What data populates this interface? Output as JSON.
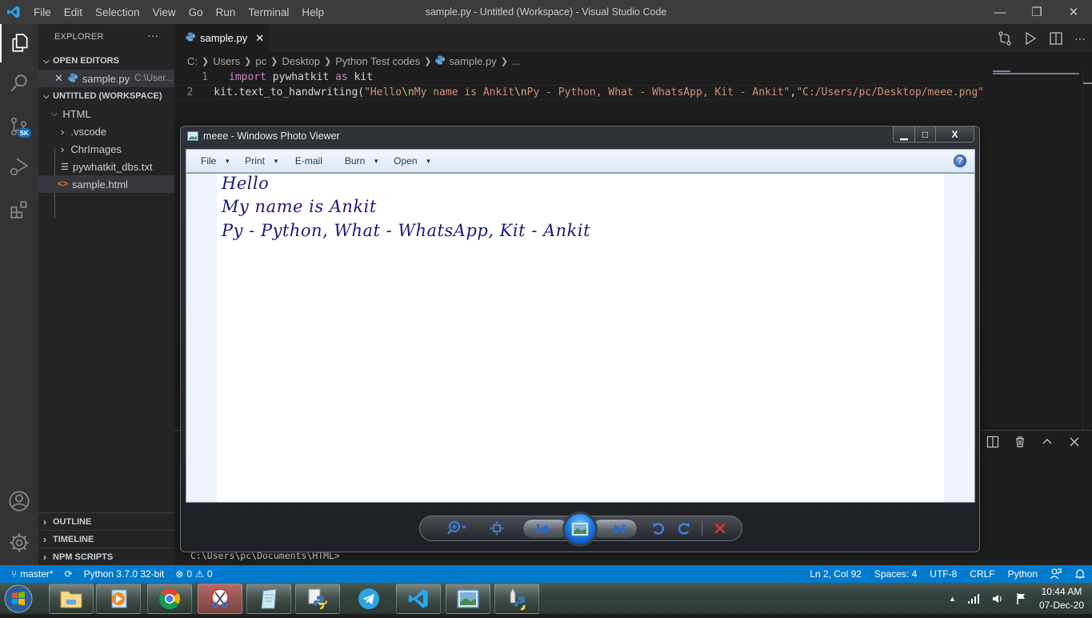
{
  "window": {
    "title": "sample.py - Untitled (Workspace) - Visual Studio Code",
    "menu": [
      "File",
      "Edit",
      "Selection",
      "View",
      "Go",
      "Run",
      "Terminal",
      "Help"
    ],
    "controls": {
      "minimize": "—",
      "restore": "❐",
      "close": "✕"
    }
  },
  "activity_bar": {
    "items": [
      "explorer",
      "search",
      "source-control",
      "run-debug",
      "extensions"
    ],
    "scm_badge": "5K",
    "bottom": [
      "accounts",
      "manage"
    ]
  },
  "sidebar": {
    "title": "EXPLORER",
    "more": "···",
    "open_editors": {
      "label": "OPEN EDITORS",
      "items": [
        {
          "name": "sample.py",
          "desc": "C:\\User..."
        }
      ]
    },
    "workspace": {
      "label": "UNTITLED (WORKSPACE)",
      "root": "HTML",
      "items": [
        {
          "name": ".vscode",
          "type": "folder"
        },
        {
          "name": "ChrImages",
          "type": "folder"
        },
        {
          "name": "pywhatkit_dbs.txt",
          "type": "text"
        },
        {
          "name": "sample.html",
          "type": "html"
        }
      ]
    },
    "bottom_sections": [
      "OUTLINE",
      "TIMELINE",
      "NPM SCRIPTS"
    ]
  },
  "editor": {
    "tab": {
      "label": "sample.py",
      "close": "✕"
    },
    "breadcrumb": [
      "C:",
      "Users",
      "pc",
      "Desktop",
      "Python Test codes",
      "sample.py",
      "..."
    ],
    "lines": [
      {
        "num": "1",
        "kw1": "import",
        "mid": " pywhatkit ",
        "kw2": "as",
        "end": " kit"
      },
      {
        "num": "2",
        "fn": "kit.text_to_handwriting(",
        "s1": "\"Hello",
        "e1": "\\n",
        "s2": "My name is Ankit",
        "e2": "\\n",
        "s3": "Py - Python, What - WhatsApp, Kit - Ankit\"",
        "comma": ",",
        "s4": "\"C:/Users/pc/Desktop/meee.png\""
      }
    ]
  },
  "panel": {
    "terminal_prompt": "C:\\Users\\pc\\Documents\\HTML>"
  },
  "statusbar": {
    "branch": "master*",
    "interpreter": "Python 3.7.0 32-bit",
    "errors": "0",
    "warnings": "0",
    "position": "Ln 2, Col 92",
    "spaces": "Spaces: 4",
    "encoding": "UTF-8",
    "eol": "CRLF",
    "language": "Python"
  },
  "photo_viewer": {
    "title": "meee - Windows Photo Viewer",
    "controls": {
      "minimize": "▁",
      "maximize": "□",
      "close": "X"
    },
    "toolbar": [
      {
        "label": "File",
        "dropdown": true
      },
      {
        "label": "Print",
        "dropdown": true
      },
      {
        "label": "E-mail",
        "dropdown": false
      },
      {
        "label": "Burn",
        "dropdown": true
      },
      {
        "label": "Open",
        "dropdown": true
      }
    ],
    "help": "?",
    "image_text": [
      "Hello",
      "My name is Ankit",
      "Py - Python, What - WhatsApp, Kit - Ankit"
    ],
    "nav_buttons": [
      "zoom",
      "actual-size",
      "previous",
      "slideshow",
      "next",
      "rotate-ccw",
      "rotate-cw",
      "delete"
    ]
  },
  "taskbar": {
    "apps": [
      "windows-explorer",
      "media-player",
      "chrome",
      "snipping-tool",
      "notepad",
      "python-file",
      "telegram",
      "vscode",
      "photo-viewer",
      "python-launcher"
    ],
    "clock": {
      "time": "10:44 AM",
      "date": "07-Dec-20"
    }
  }
}
